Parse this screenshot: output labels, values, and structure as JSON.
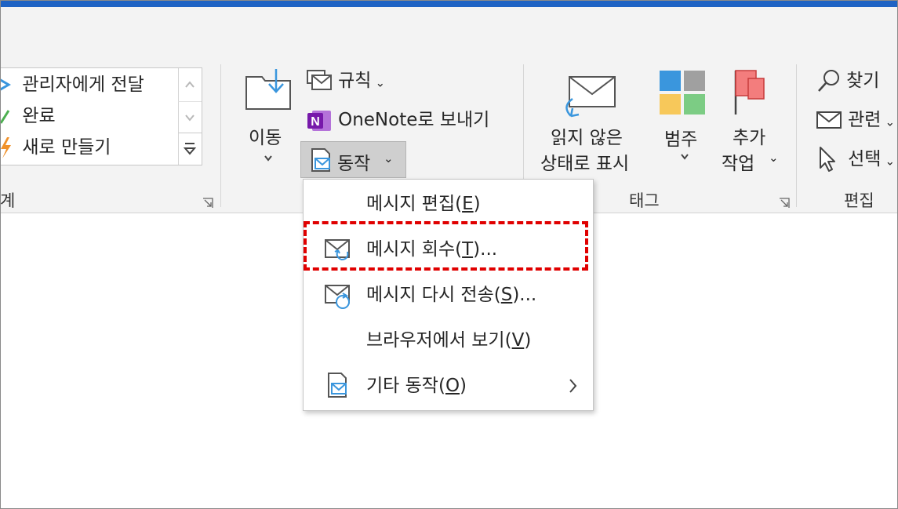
{
  "ribbon": {
    "quick_steps": {
      "items": [
        "관리자에게 전달",
        "완료",
        "새로 만들기"
      ],
      "group_label": "계"
    },
    "move": {
      "move_label": "이동",
      "rules_label": "규칙",
      "onenote_label": "OneNote로 보내기",
      "actions_label": "동작"
    },
    "tags": {
      "unread_line1": "읽지 않은",
      "unread_line2": "상태로 표시",
      "categorize_label": "범주",
      "followup_line1": "추가",
      "followup_line2": "작업",
      "group_label": "태그"
    },
    "editing": {
      "find_label": "찾기",
      "related_label": "관련",
      "select_label": "선택",
      "group_label": "편집"
    }
  },
  "actions_menu": {
    "items": [
      {
        "label": "메시지 편집(",
        "accel": "E",
        "tail": ")"
      },
      {
        "label": "메시지 회수(",
        "accel": "T",
        "tail": ")..."
      },
      {
        "label": "메시지 다시 전송(",
        "accel": "S",
        "tail": ")..."
      },
      {
        "label": "브라우저에서 보기(",
        "accel": "V",
        "tail": ")"
      },
      {
        "label": "기타 동작(",
        "accel": "O",
        "tail": ")"
      }
    ]
  },
  "colors": {
    "title_bar": "#1f63c4",
    "highlight_border": "#e00000",
    "onenote_purple": "#7719aa",
    "accent_blue": "#3a96dd"
  }
}
